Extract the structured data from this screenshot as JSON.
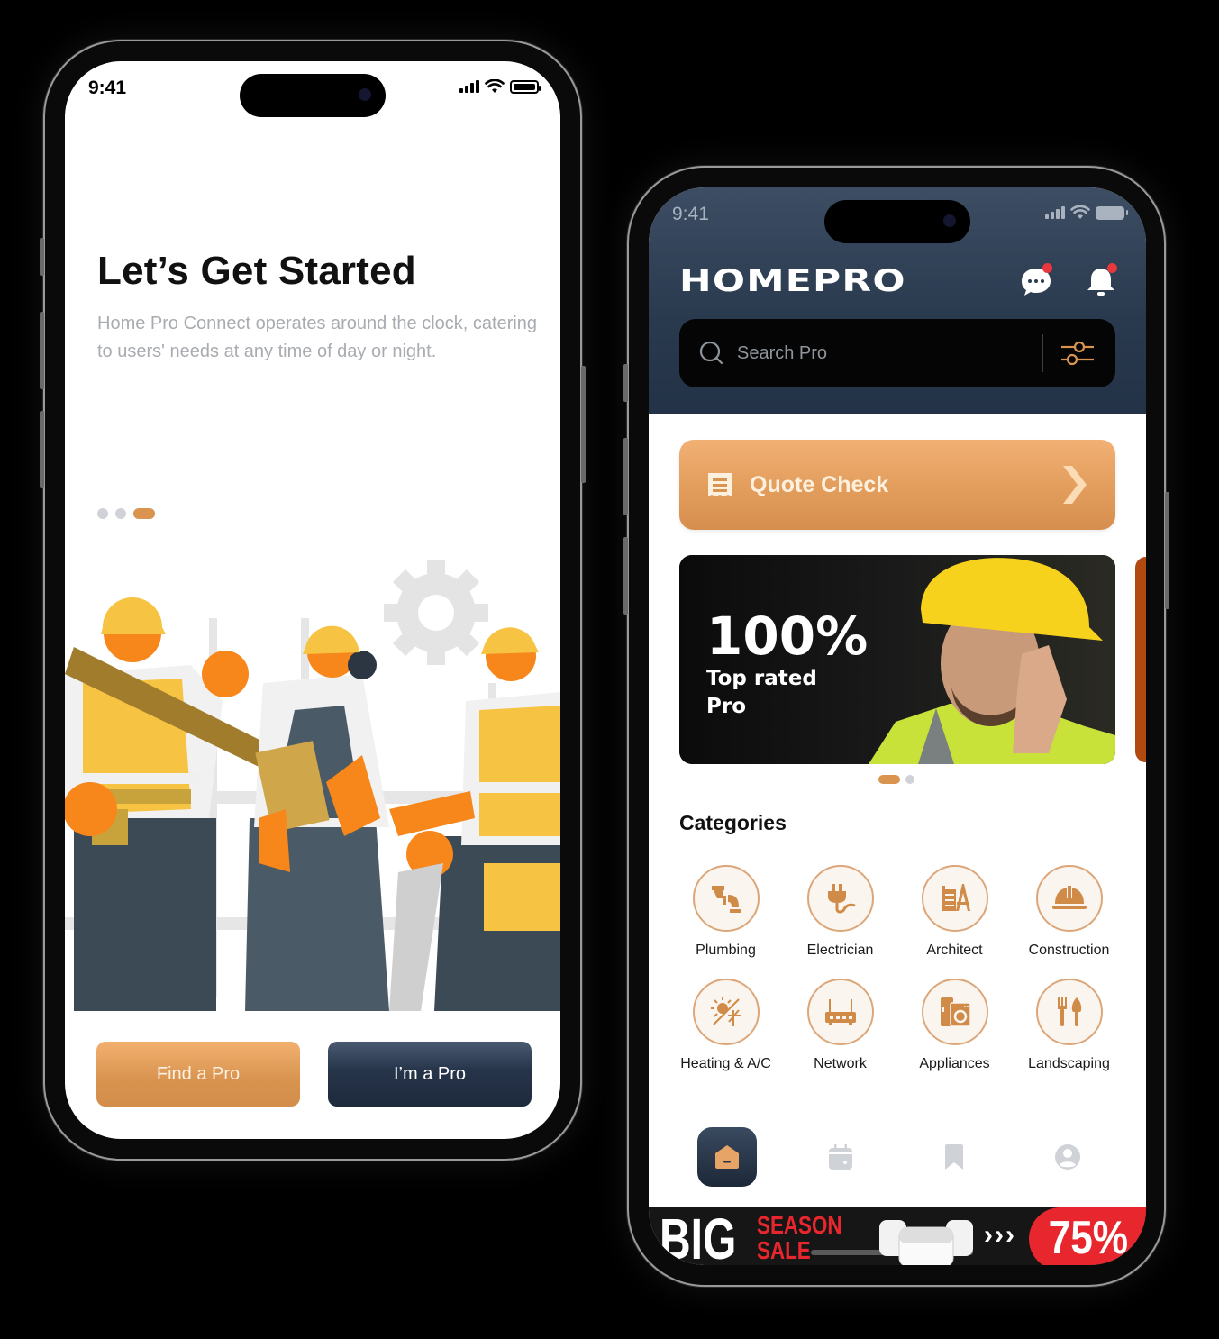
{
  "left_phone": {
    "status_bar": {
      "time": "9:41"
    },
    "onboarding": {
      "title": "Let’s Get Started",
      "description": "Home Pro Connect operates around the clock, catering to users' needs at any time of day or night.",
      "page_indicator": {
        "total": 3,
        "active_index": 2
      },
      "illustration": "construction-workers-illustration"
    },
    "buttons": {
      "find_pro": "Find a Pro",
      "im_pro": "I’m a Pro"
    }
  },
  "right_phone": {
    "status_bar": {
      "time": "9:41"
    },
    "header": {
      "logo": "HOMEPRO",
      "chat_icon": "chat-bubble-icon",
      "bell_icon": "bell-icon",
      "chat_has_badge": true,
      "bell_has_badge": true
    },
    "search": {
      "placeholder": "Search Pro",
      "value": ""
    },
    "quote_check": {
      "label": "Quote Check",
      "icon": "receipt-icon"
    },
    "promo": {
      "headline": "100%",
      "subtitle": "Top rated Pro",
      "page_indicator": {
        "total": 2,
        "active_index": 0
      }
    },
    "categories": {
      "title": "Categories",
      "items": [
        {
          "label": "Plumbing",
          "icon": "pipe-icon"
        },
        {
          "label": "Electrician",
          "icon": "plug-icon"
        },
        {
          "label": "Architect",
          "icon": "blueprint-compass-icon"
        },
        {
          "label": "Construction",
          "icon": "hard-hat-icon"
        },
        {
          "label": "Heating & A/C",
          "icon": "sun-snowflake-icon"
        },
        {
          "label": "Network",
          "icon": "router-icon"
        },
        {
          "label": "Appliances",
          "icon": "washer-fridge-icon"
        },
        {
          "label": "Landscaping",
          "icon": "garden-tools-icon"
        }
      ]
    },
    "tabbar": {
      "items": [
        {
          "name": "home",
          "icon": "home-icon",
          "active": true
        },
        {
          "name": "calendar",
          "icon": "calendar-icon",
          "active": false
        },
        {
          "name": "bookmarks",
          "icon": "bookmark-icon",
          "active": false
        },
        {
          "name": "profile",
          "icon": "profile-icon",
          "active": false
        }
      ]
    },
    "ad_banner": {
      "big": "BIG",
      "line1": "SEASON",
      "line2": "SALE",
      "arrows": "›››",
      "discount": "75%"
    }
  },
  "colors": {
    "accent_orange": "#D99550",
    "navy": "#233246",
    "badge_red": "#E8383D",
    "sale_red": "#E8262D"
  }
}
